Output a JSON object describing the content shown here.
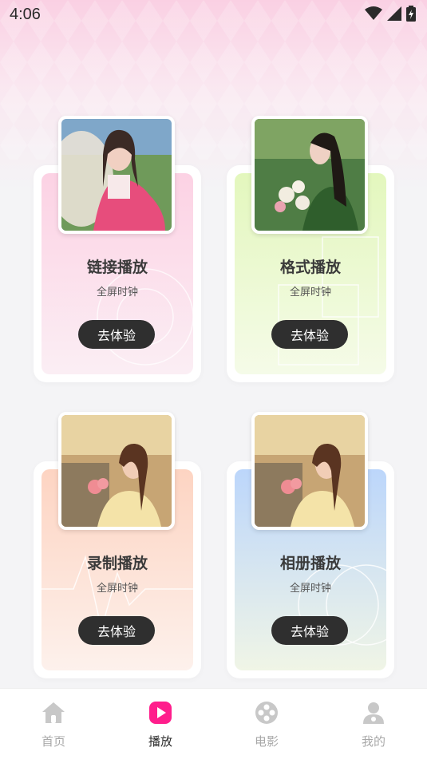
{
  "status_bar": {
    "time": "4:06"
  },
  "cards": [
    {
      "title": "链接播放",
      "subtitle": "全屏时钟",
      "button": "去体验",
      "gradient_top": "#fcd2e4",
      "gradient_bottom": "#fbeef4"
    },
    {
      "title": "格式播放",
      "subtitle": "全屏时钟",
      "button": "去体验",
      "gradient_top": "#e3f7bd",
      "gradient_bottom": "#f5fbe8"
    },
    {
      "title": "录制播放",
      "subtitle": "全屏时钟",
      "button": "去体验",
      "gradient_top": "#fdd4c2",
      "gradient_bottom": "#fdf1ec"
    },
    {
      "title": "相册播放",
      "subtitle": "全屏时钟",
      "button": "去体验",
      "gradient_top": "#bcd6fb",
      "gradient_bottom": "#f0f5e6"
    }
  ],
  "bottom_nav": [
    {
      "label": "首页",
      "icon": "home-icon",
      "active": false
    },
    {
      "label": "播放",
      "icon": "play-icon",
      "active": true
    },
    {
      "label": "电影",
      "icon": "film-reel-icon",
      "active": false
    },
    {
      "label": "我的",
      "icon": "user-icon",
      "active": false
    }
  ],
  "colors": {
    "accent": "#ff1e8c",
    "button_bg": "#2f2f2f",
    "inactive": "#c8c8c8"
  }
}
